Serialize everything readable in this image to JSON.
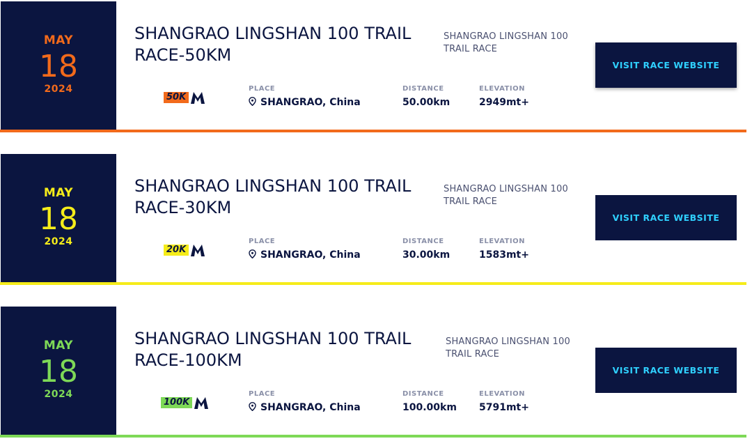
{
  "races": [
    {
      "month": "MAY",
      "day": "18",
      "year": "2024",
      "accent": "#f26a1b",
      "title": "SHANGRAO LINGSHAN 100 TRAIL RACE-50KM",
      "organizer": "SHANGRAO LINGSHAN 100 TRAIL RACE",
      "badge": "50K",
      "place_label": "PLACE",
      "place": "SHANGRAO, China",
      "distance_label": "DISTANCE",
      "distance": "50.00km",
      "elevation_label": "ELEVATION",
      "elevation": "2949mt+",
      "button": "VISIT RACE WEBSITE"
    },
    {
      "month": "MAY",
      "day": "18",
      "year": "2024",
      "accent": "#f5ec1a",
      "title": "SHANGRAO LINGSHAN 100 TRAIL RACE-30KM",
      "organizer": "SHANGRAO LINGSHAN 100 TRAIL RACE",
      "badge": "20K",
      "place_label": "PLACE",
      "place": "SHANGRAO, China",
      "distance_label": "DISTANCE",
      "distance": "30.00km",
      "elevation_label": "ELEVATION",
      "elevation": "1583mt+",
      "button": "VISIT RACE WEBSITE"
    },
    {
      "month": "MAY",
      "day": "18",
      "year": "2024",
      "accent": "#7ed957",
      "title": "SHANGRAO LINGSHAN 100 TRAIL RACE-100KM",
      "organizer": "SHANGRAO LINGSHAN 100 TRAIL RACE",
      "badge": "100K",
      "place_label": "PLACE",
      "place": "SHANGRAO, China",
      "distance_label": "DISTANCE",
      "distance": "100.00km",
      "elevation_label": "ELEVATION",
      "elevation": "5791mt+",
      "button": "VISIT RACE WEBSITE"
    }
  ],
  "icons": {
    "place": "location-pin-icon",
    "badge_logo": "m-logo-icon"
  }
}
